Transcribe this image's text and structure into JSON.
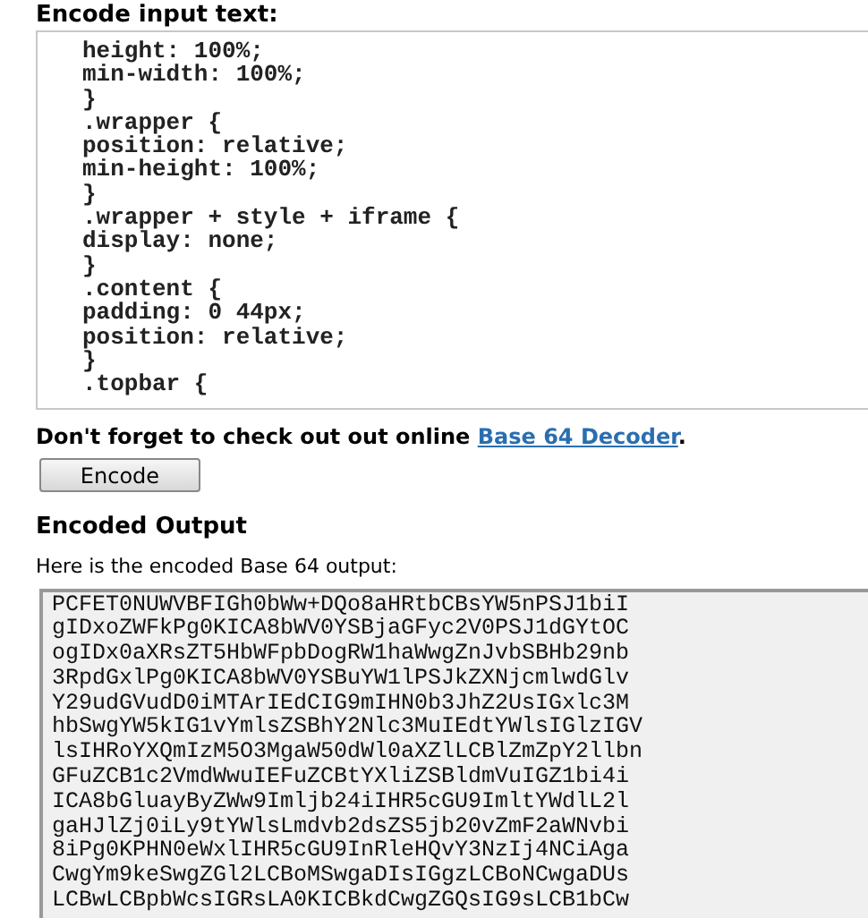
{
  "input_section": {
    "heading": "Encode input text:",
    "lines": [
      "height: 100%;",
      "min-width: 100%;",
      "}",
      ".wrapper {",
      "position: relative;",
      "min-height: 100%;",
      "}",
      ".wrapper + style + iframe {",
      "display: none;",
      "}",
      ".content {",
      "padding: 0 44px;",
      "position: relative;",
      "}",
      ".topbar {"
    ]
  },
  "notice": {
    "text": "Don't forget to check out out online",
    "link": "Base 64 Decoder",
    "end": "."
  },
  "encode_button": "Encode",
  "output_section": {
    "heading": "Encoded Output",
    "caption": "Here is the encoded Base 64 output:",
    "lines": [
      "PCFET0NUWVBFIGh0bWw+DQo8aHRtbCBsYW5nPSJ1biI",
      "gIDxoZWFkPg0KICA8bWV0YSBjaGFyc2V0PSJ1dGYtOC",
      "ogIDx0aXRsZT5HbWFpbDogRW1haWwgZnJvbSBHb29nb",
      "3RpdGxlPg0KICA8bWV0YSBuYW1lPSJkZXNjcmlwdGlv",
      "Y29udGVudD0iMTArIEdCIG9mIHN0b3JhZ2UsIGxlc3M",
      "hbSwgYW5kIG1vYmlsZSBhY2Nlc3MuIEdtYWlsIGlzIGV",
      "lsIHRoYXQmIzM5O3MgaW50dWl0aXZlLCBlZmZpY2llbn",
      "GFuZCB1c2VmdWwuIEFuZCBtYXliZSBldmVuIGZ1bi4i",
      "ICA8bGluayByZWw9Imljb24iIHR5cGU9ImltYWdlL2l",
      "gaHJlZj0iLy9tYWlsLmdvb2dsZS5jb20vZmF2aWNvbi",
      "8iPg0KPHN0eWxlIHR5cGU9InRleHQvY3NzIj4NCiAga",
      "CwgYm9keSwgZGl2LCBoMSwgaDIsIGgzLCBoNCwgaDUs",
      "LCBwLCBpbWcsIGRsLA0KICBkdCwgZGQsIG9sLCB1bCw"
    ]
  }
}
